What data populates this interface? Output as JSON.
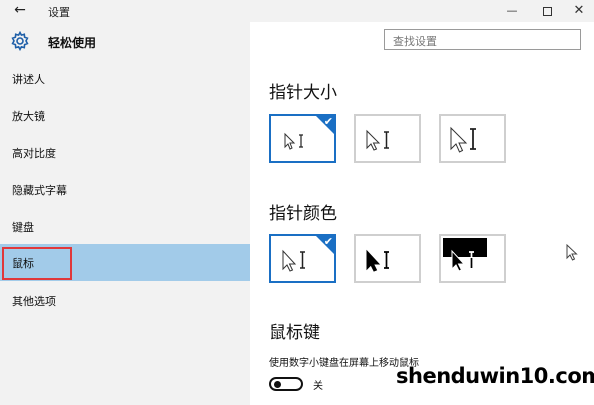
{
  "titlebar": {
    "title": "设置",
    "back_glyph": "←",
    "minimize_glyph": "—",
    "close_glyph": "✕"
  },
  "app": {
    "title": "轻松使用",
    "icon": "gear-icon"
  },
  "search": {
    "placeholder": "查找设置"
  },
  "nav": {
    "items": [
      {
        "label": "讲述人"
      },
      {
        "label": "放大镜"
      },
      {
        "label": "高对比度"
      },
      {
        "label": "隐藏式字幕"
      },
      {
        "label": "键盘"
      },
      {
        "label": "鼠标",
        "selected": true
      },
      {
        "label": "其他选项"
      }
    ]
  },
  "main": {
    "pointer_size": {
      "title": "指针大小",
      "options": [
        {
          "name": "small",
          "selected": true
        },
        {
          "name": "medium",
          "selected": false
        },
        {
          "name": "large",
          "selected": false
        }
      ]
    },
    "pointer_color": {
      "title": "指针颜色",
      "options": [
        {
          "name": "white",
          "selected": true
        },
        {
          "name": "black",
          "selected": false
        },
        {
          "name": "inverted",
          "selected": false
        }
      ]
    },
    "mouse_keys": {
      "title": "鼠标键",
      "description": "使用数字小键盘在屏幕上移动鼠标",
      "toggle_state": "关",
      "toggle_on": false
    }
  },
  "colors": {
    "accent": "#1a6fc4",
    "selected_nav": "#a2cbe9",
    "highlight_border": "#e0383b",
    "pane_bg": "#f2f2f2"
  },
  "watermark": "shenduwin10.com"
}
